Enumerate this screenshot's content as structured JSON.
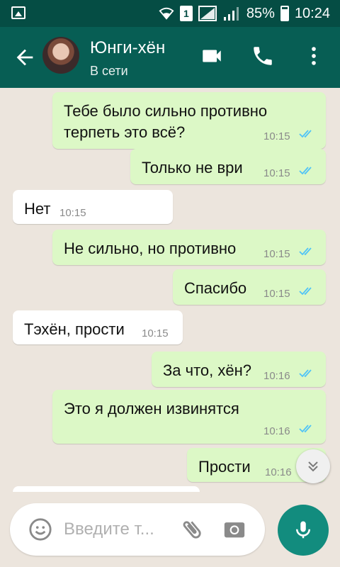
{
  "status_bar": {
    "sim": "1",
    "battery": "85%",
    "time": "10:24"
  },
  "header": {
    "contact_name": "Юнги-хён",
    "contact_status": "В сети"
  },
  "messages": [
    {
      "dir": "out",
      "text_lines": [
        "Тебе было сильно противно",
        "терпеть это всё?"
      ],
      "time": "10:15",
      "read": true
    },
    {
      "dir": "out",
      "text_lines": [
        "Только не ври"
      ],
      "time": "10:15",
      "read": true
    },
    {
      "dir": "in",
      "text_lines": [
        "Нет"
      ],
      "time": "10:15"
    },
    {
      "dir": "out",
      "text_lines": [
        "Не сильно, но противно"
      ],
      "time": "10:15",
      "read": true
    },
    {
      "dir": "out",
      "text_lines": [
        "Спасибо"
      ],
      "time": "10:15",
      "read": true
    },
    {
      "dir": "in",
      "text_lines": [
        "Тэхён, прости"
      ],
      "time": "10:15"
    },
    {
      "dir": "out",
      "text_lines": [
        "За что, хён?"
      ],
      "time": "10:16",
      "read": true
    },
    {
      "dir": "out",
      "text_lines": [
        "Это я должен извинятся"
      ],
      "time": "10:16",
      "read": true
    },
    {
      "dir": "out",
      "text_lines": [
        "Прости"
      ],
      "time": "10:16",
      "read": true
    }
  ],
  "composer": {
    "placeholder": "Введите т..."
  },
  "colors": {
    "header": "#075e54",
    "status_bar": "#054d44",
    "out_bubble": "#dcf8c6",
    "in_bubble": "#ffffff",
    "read_ticks": "#4fc3f7",
    "fab": "#128c7e"
  },
  "icons": [
    "gallery-icon",
    "wifi-icon",
    "signal-icon",
    "battery-icon",
    "back-arrow-icon",
    "video-call-icon",
    "phone-icon",
    "more-vert-icon",
    "emoji-icon",
    "attach-icon",
    "camera-icon",
    "mic-icon",
    "chevron-down-icon"
  ]
}
